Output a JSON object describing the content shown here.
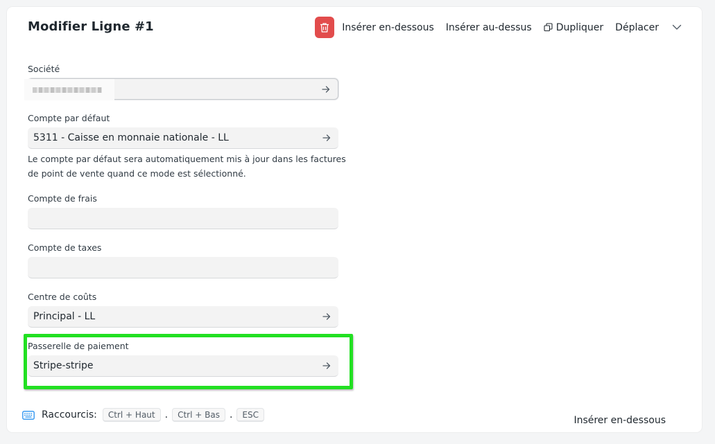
{
  "header": {
    "title": "Modifier Ligne #1",
    "actions": {
      "delete_icon": "trash-icon",
      "insert_below": "Insérer en-dessous",
      "insert_above": "Insérer au-dessus",
      "duplicate": "Dupliquer",
      "move": "Déplacer"
    }
  },
  "form": {
    "company": {
      "label": "Société",
      "value": ""
    },
    "default_account": {
      "label": "Compte par défaut",
      "value": "5311 - Caisse en monnaie nationale - LL",
      "help": "Le compte par défaut sera automatiquement mis à jour dans les factures de point de vente quand ce mode est sélectionné."
    },
    "expense_account": {
      "label": "Compte de frais",
      "value": ""
    },
    "tax_account": {
      "label": "Compte de taxes",
      "value": ""
    },
    "cost_center": {
      "label": "Centre de coûts",
      "value": "Principal - LL"
    },
    "payment_gateway": {
      "label": "Passerelle de paiement",
      "value": "Stripe-stripe"
    }
  },
  "footer": {
    "shortcuts_label": "Raccourcis:",
    "shortcut_1": "Ctrl + Haut",
    "shortcut_2": "Ctrl + Bas",
    "shortcut_3": "ESC",
    "separator": ".",
    "action": "Insérer en-dessous"
  },
  "colors": {
    "delete_button": "#e24c4c",
    "highlight": "#22e022",
    "input_bg": "#f3f3f3"
  }
}
